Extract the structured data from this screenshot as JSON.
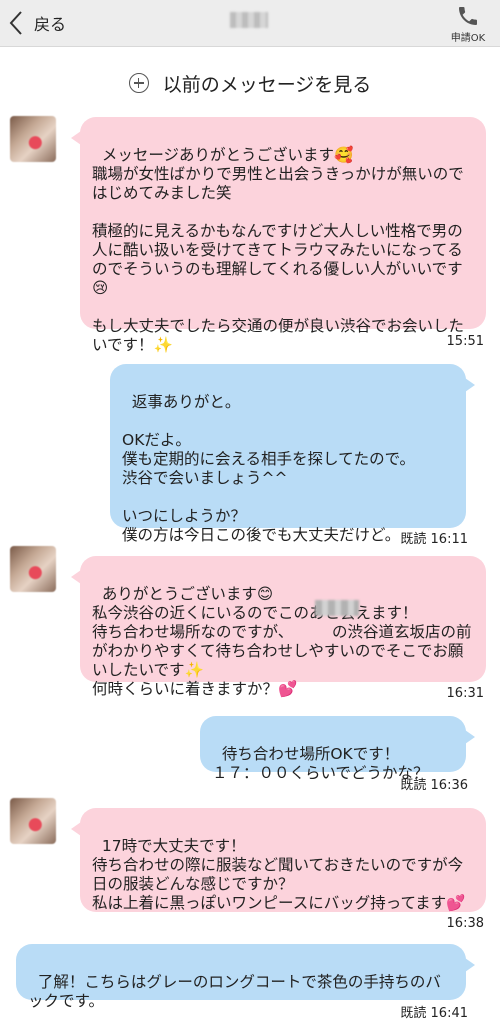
{
  "header": {
    "back_label": "戻る",
    "call_label": "申請OK"
  },
  "earlier_messages_label": "以前のメッセージを見る",
  "messages": [
    {
      "text": "メッセージありがとうございます🥰\n職場が女性ばかりで男性と出会うきっかけが無いのではじめてみました笑\n\n積極的に見えるかもなんですけど大人しい性格で男の人に酷い扱いを受けてきてトラウマみたいになってるのでそういうのも理解してくれる優しい人がいいです😢\n\nもし大丈夫でしたら交通の便が良い渋谷でお会いしたいです！✨",
      "time": "15:51"
    },
    {
      "text": "返事ありがと。\n\nOKだよ。\n僕も定期的に会える相手を探してたので。\n渋谷で会いましょう^^\n\nいつにしようか？\n僕の方は今日この後でも大丈夫だけど。",
      "time": "既読  16:11"
    },
    {
      "text": "ありがとうございます😊\n私今渋谷の近くにいるのでこのあと会えます！\n待ち合わせ場所なのですが、　　　の渋谷道玄坂店の前がわかりやすくて待ち合わせしやすいのでそこでお願いしたいです✨\n何時くらいに着きますか？💕",
      "time": "16:31"
    },
    {
      "text": "待ち合わせ場所OKです！\n１７：００くらいでどうかな？",
      "time": "既読  16:36"
    },
    {
      "text": "17時で大丈夫です！\n待ち合わせの際に服装など聞いておきたいのですが今日の服装どんな感じですか？\n私は上着に黒っぽいワンピースにバッグ持ってます💕",
      "time": "16:38"
    },
    {
      "text": "了解！こちらはグレーのロングコートで茶色の手持ちのバックです。",
      "time": "既読  16:41"
    }
  ]
}
